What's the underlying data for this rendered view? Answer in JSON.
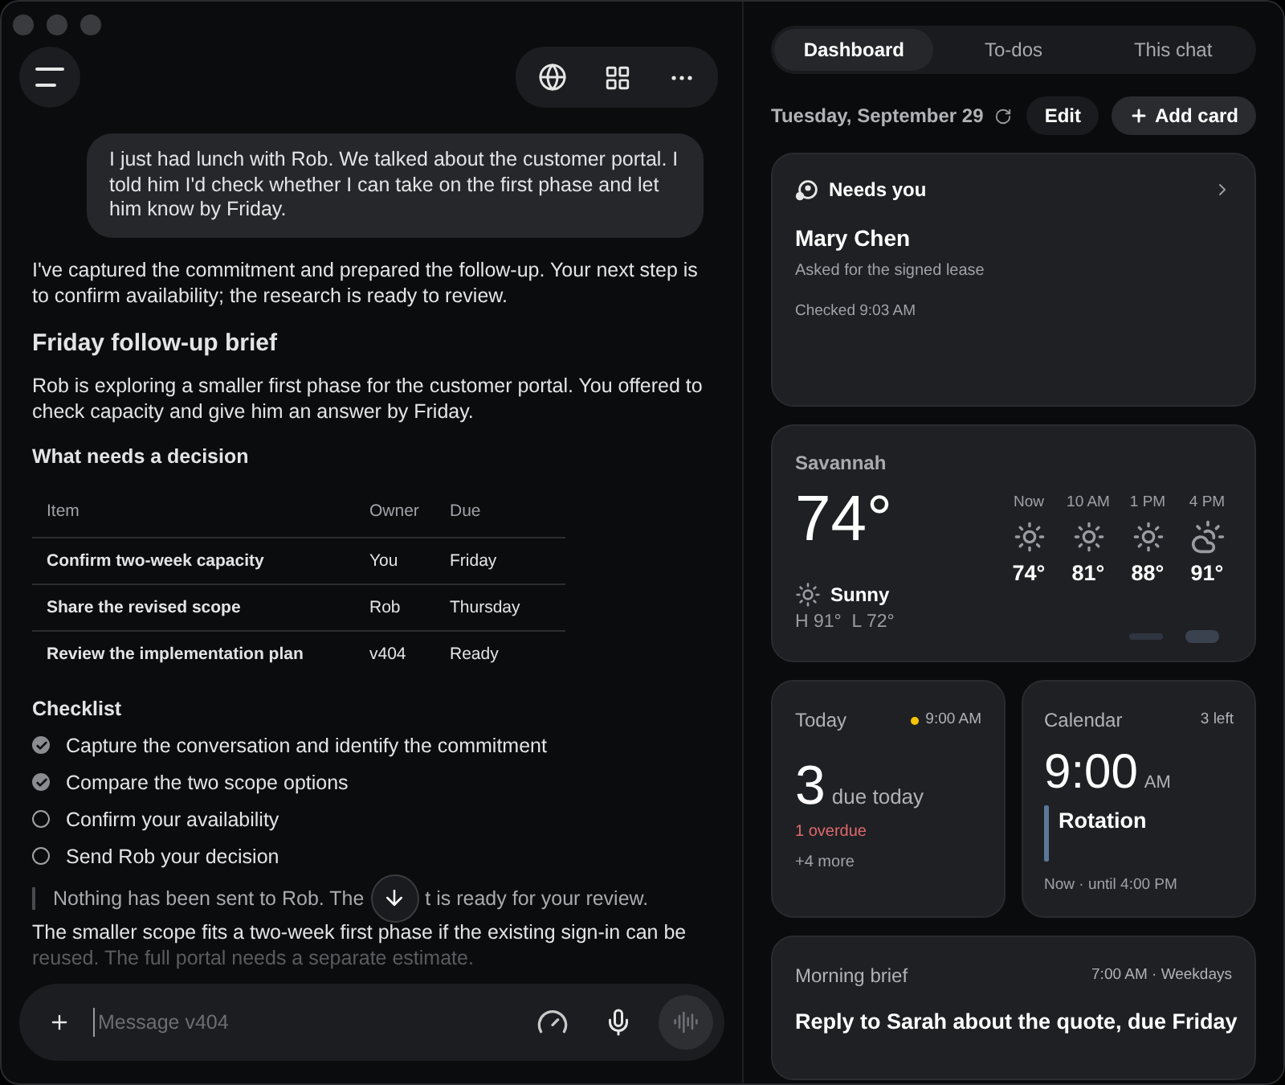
{
  "chat": {
    "user_message": "I just had lunch with Rob. We talked about the customer portal. I told him I'd check whether I can take on the first phase and let him know by Friday.",
    "reply_intro": "I've captured the commitment and prepared the follow-up. Your next step is to confirm availability; the research is ready to review.",
    "brief_title": "Friday follow-up brief",
    "brief_text": "Rob is exploring a smaller first phase for the customer portal. You offered to check capacity and give him an answer by Friday.",
    "decision_title": "What needs a decision",
    "table": {
      "columns": [
        "Item",
        "Owner",
        "Due"
      ],
      "rows": [
        {
          "cells": [
            "Confirm two-week capacity",
            "You",
            "Friday"
          ]
        },
        {
          "cells": [
            "Share the revised scope",
            "Rob",
            "Thursday"
          ]
        },
        {
          "cells": [
            "Review the implementation plan",
            "v404",
            "Ready"
          ]
        }
      ]
    },
    "checklist_title": "Checklist",
    "checklist": [
      {
        "label": "Capture the conversation and identify the commitment",
        "checked": true
      },
      {
        "label": "Compare the two scope options",
        "checked": true
      },
      {
        "label": "Confirm your availability",
        "checked": false
      },
      {
        "label": "Send Rob your decision",
        "checked": false
      }
    ],
    "note_before": "Nothing has been sent to Rob. The",
    "note_after": "t is ready for your review.",
    "closing_line_1": "The smaller scope fits a two-week first phase if the existing sign-in can be",
    "closing_line_2": "reused. The full portal needs a separate estimate.",
    "composer": {
      "placeholder": "Message v404"
    }
  },
  "side": {
    "tabs": [
      {
        "label": "Dashboard",
        "selected": true
      },
      {
        "label": "To-dos",
        "selected": false
      },
      {
        "label": "This chat",
        "selected": false
      }
    ],
    "date": "Tuesday, September 29",
    "edit": "Edit",
    "add_card": "Add card",
    "needs_you": {
      "title": "Needs you",
      "name": "Mary Chen",
      "detail": "Asked for the signed lease",
      "checked": "Checked 9:03 AM"
    },
    "weather": {
      "city": "Savannah",
      "temp": "74°",
      "condition": "Sunny",
      "hilo": "H 91°  L 72°",
      "hours": [
        {
          "time": "Now",
          "kind": "sun",
          "temp": "74°"
        },
        {
          "time": "10 AM",
          "kind": "sun",
          "temp": "81°"
        },
        {
          "time": "1 PM",
          "kind": "sun",
          "temp": "88°"
        },
        {
          "time": "4 PM",
          "kind": "cloud",
          "temp": "91°"
        }
      ],
      "pages": [
        {
          "selected": false
        },
        {
          "selected": true
        }
      ]
    },
    "today": {
      "title": "Today",
      "time": "9:00 AM",
      "count": "3",
      "count_label": "due today",
      "overdue": "1 overdue",
      "more": "+4 more"
    },
    "calendar": {
      "title": "Calendar",
      "left": "3 left",
      "time": "9:00",
      "ampm": "AM",
      "event": "Rotation",
      "when": "Now · until 4:00 PM"
    },
    "brief": {
      "title": "Morning brief",
      "schedule": "7:00 AM · Weekdays",
      "text": "Reply to Sarah about the quote, due Friday"
    }
  }
}
